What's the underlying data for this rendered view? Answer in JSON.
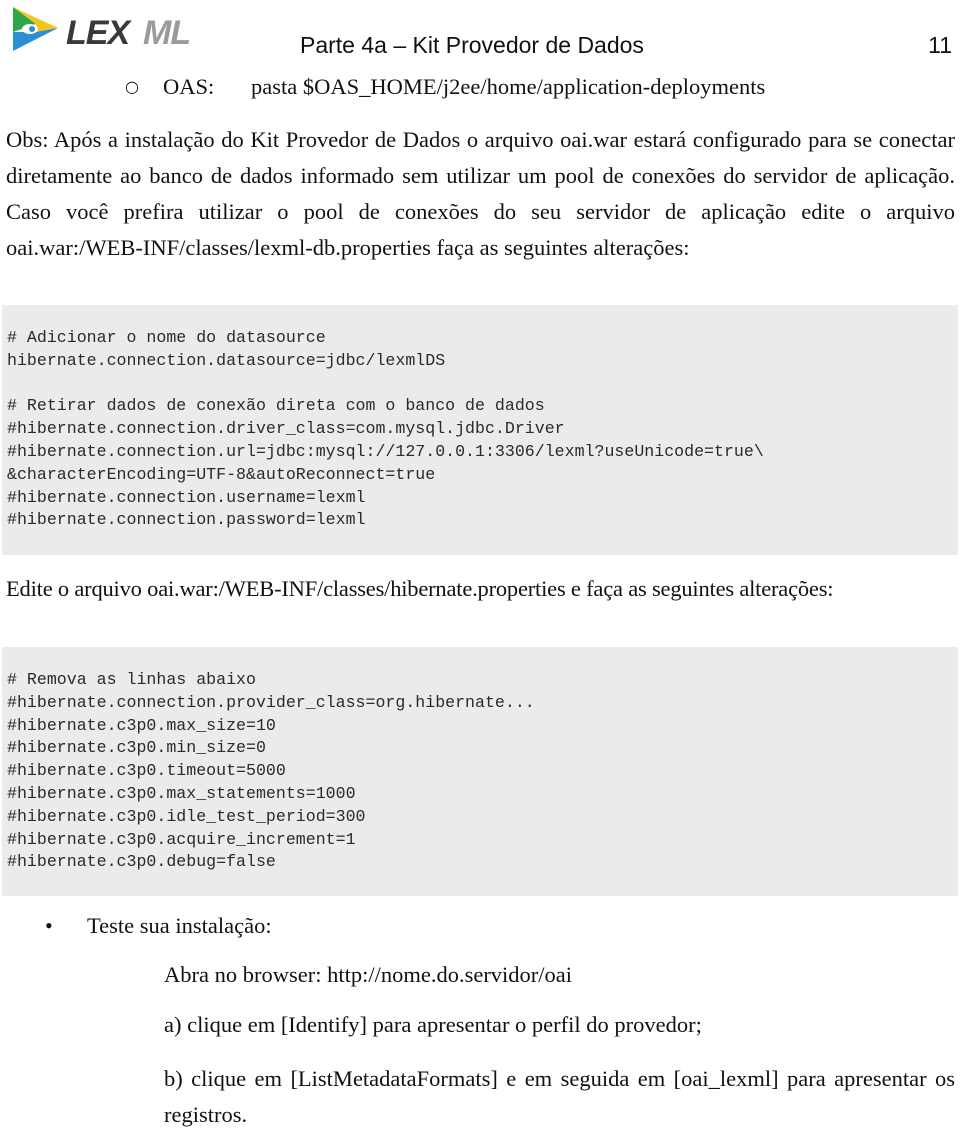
{
  "header": {
    "logo": {
      "text_primary": "LEX",
      "text_secondary": "ML",
      "icon": "lexml-play-triangle-icon",
      "colors": {
        "green": "#2aa84a",
        "yellow": "#f4c51c",
        "blue": "#2a8fd6",
        "text_dark": "#3a3a3a",
        "text_light": "#9a9a9a"
      }
    },
    "title": "Parte 4a – Kit Provedor de Dados",
    "page_number": "11"
  },
  "oas_item": {
    "bullet": "○",
    "label": "OAS:",
    "value": "pasta $OAS_HOME/j2ee/home/application-deployments"
  },
  "obs_paragraph": "Obs: Após a instalação do Kit Provedor de Dados o arquivo oai.war estará configurado para se conectar diretamente ao banco de dados informado sem utilizar um pool de conexões do servidor de aplicação. Caso você prefira utilizar o pool de conexões do seu servidor de aplicação edite o arquivo oai.war:/WEB-INF/classes/lexml-db.properties faça as seguintes alterações:",
  "code_block_1": {
    "background": "#ebebeb",
    "lines": [
      "# Adicionar o nome do datasource",
      "hibernate.connection.datasource=jdbc/lexmlDS",
      "",
      "# Retirar dados de conexão direta com o banco de dados",
      "#hibernate.connection.driver_class=com.mysql.jdbc.Driver",
      "#hibernate.connection.url=jdbc:mysql://127.0.0.1:3306/lexml?useUnicode=true\\",
      "&characterEncoding=UTF-8&autoReconnect=true",
      "#hibernate.connection.username=lexml",
      "#hibernate.connection.password=lexml"
    ]
  },
  "edit_paragraph": "Edite o arquivo oai.war:/WEB-INF/classes/hibernate.properties e faça as seguintes alterações:",
  "code_block_2": {
    "background": "#ebebeb",
    "lines": [
      "# Remova as linhas abaixo",
      "#hibernate.connection.provider_class=org.hibernate...",
      "#hibernate.c3p0.max_size=10",
      "#hibernate.c3p0.min_size=0",
      "#hibernate.c3p0.timeout=5000",
      "#hibernate.c3p0.max_statements=1000",
      "#hibernate.c3p0.idle_test_period=300",
      "#hibernate.c3p0.acquire_increment=1",
      "#hibernate.c3p0.debug=false"
    ]
  },
  "test_section": {
    "bullet": "•",
    "heading": "Teste sua instalação:",
    "open_browser": "Abra no browser: http://nome.do.servidor/oai",
    "step_a": "a) clique em [Identify]  para apresentar o perfil do provedor;",
    "step_b": "b) clique em [ListMetadataFormats] e em seguida em [oai_lexml] para apresentar os registros."
  }
}
